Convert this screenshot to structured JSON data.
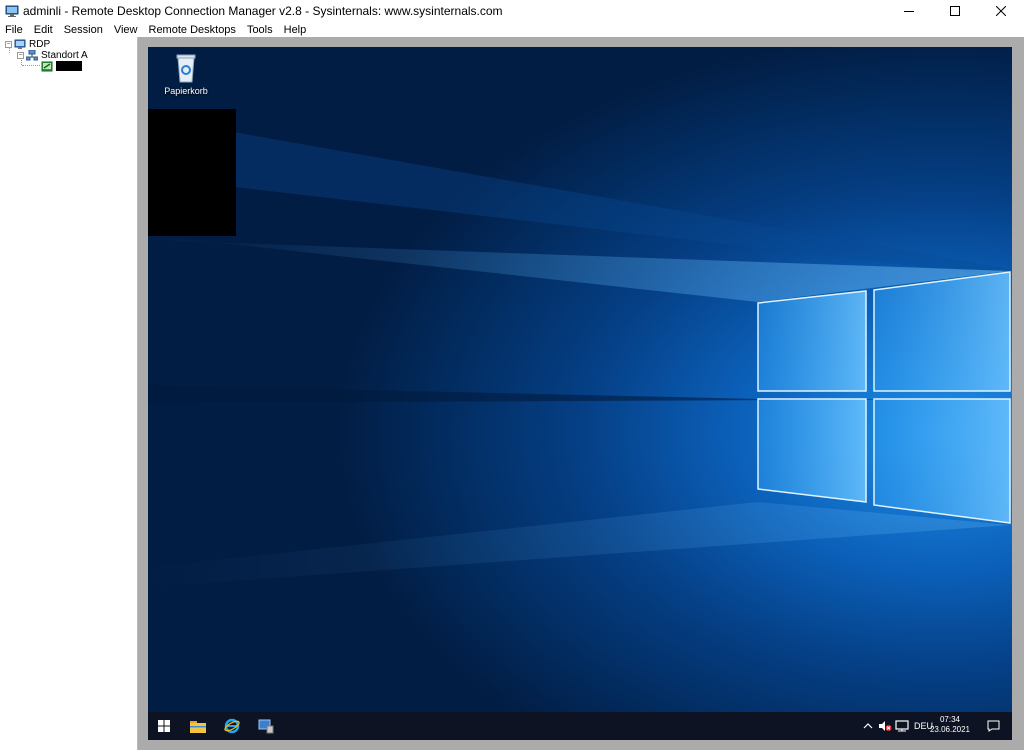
{
  "window": {
    "title": "adminli - Remote Desktop Connection Manager v2.8 - Sysinternals: www.sysinternals.com"
  },
  "menu": {
    "items": [
      "File",
      "Edit",
      "Session",
      "View",
      "Remote Desktops",
      "Tools",
      "Help"
    ]
  },
  "tree": {
    "root": "RDP",
    "group": "Standort A"
  },
  "desktop": {
    "recycle_bin_label": "Papierkorb"
  },
  "taskbar": {
    "language": "DEU",
    "time": "07:34",
    "date": "23.06.2021"
  },
  "colors": {
    "taskbar": "#0d1322",
    "frame": "#ababab",
    "desktop_accent": "#1d8ee8"
  }
}
